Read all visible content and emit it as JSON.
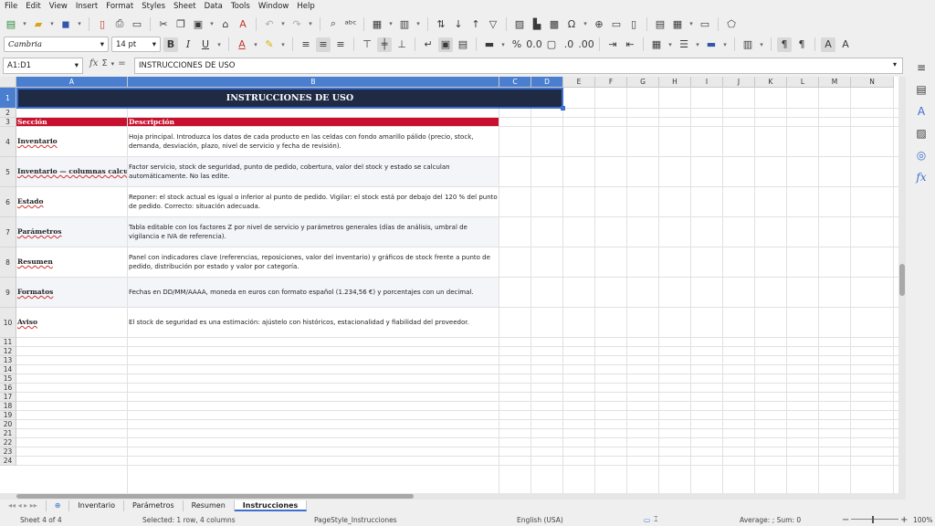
{
  "menu": [
    "File",
    "Edit",
    "View",
    "Insert",
    "Format",
    "Styles",
    "Sheet",
    "Data",
    "Tools",
    "Window",
    "Help"
  ],
  "font_name": "Cambria",
  "font_size": "14 pt",
  "name_box": "A1:D1",
  "formula": "INSTRUCCIONES DE USO",
  "columns": [
    "A",
    "B",
    "C",
    "D",
    "E",
    "F",
    "G",
    "H",
    "I",
    "J",
    "K",
    "L",
    "M",
    "N"
  ],
  "rows": [
    "1",
    "2",
    "3",
    "4",
    "5",
    "6",
    "7",
    "8",
    "9",
    "10",
    "11",
    "12",
    "13",
    "14",
    "15",
    "16",
    "17",
    "18",
    "19",
    "20",
    "21",
    "22",
    "23",
    "24"
  ],
  "title": "INSTRUCCIONES DE USO",
  "table": {
    "header_section": "Sección",
    "header_desc": "Descripción",
    "rows": [
      {
        "section": "Inventario",
        "desc": "Hoja principal. Introduzca los datos de cada producto en las celdas con fondo amarillo pálido (precio, stock, demanda, desviación, plazo, nivel de servicio y fecha de revisión)."
      },
      {
        "section": "Inventario — columnas calculadas",
        "desc": "Factor servicio, stock de seguridad, punto de pedido, cobertura, valor del stock y estado se calculan automáticamente. No las edite."
      },
      {
        "section": "Estado",
        "desc": "Reponer: el stock actual es igual o inferior al punto de pedido. Vigilar: el stock está por debajo del 120 % del punto de pedido. Correcto: situación adecuada."
      },
      {
        "section": "Parámetros",
        "desc": "Tabla editable con los factores Z por nivel de servicio y parámetros generales (días de análisis, umbral de vigilancia e IVA de referencia)."
      },
      {
        "section": "Resumen",
        "desc": "Panel con indicadores clave (referencias, reposiciones, valor del inventario) y gráficos de stock frente a punto de pedido, distribución por estado y valor por categoría."
      },
      {
        "section": "Formatos",
        "desc": "Fechas en DD/MM/AAAA, moneda en euros con formato español (1.234,56 €) y porcentajes con un decimal."
      },
      {
        "section": "Aviso",
        "desc": "El stock de seguridad es una estimación: ajústelo con históricos, estacionalidad y fiabilidad del proveedor."
      }
    ]
  },
  "tabs": [
    "Inventario",
    "Parámetros",
    "Resumen",
    "Instrucciones"
  ],
  "tab_add": "⊕",
  "status": {
    "sheet": "Sheet 4 of 4",
    "selected": "Selected: 1 row, 4 columns",
    "style": "PageStyle_Instrucciones",
    "lang": "English (USA)",
    "avg": "Average: ; Sum: 0",
    "zoom": "100%"
  },
  "accent": "#3b6fd0",
  "title_bg": "#1f2a44",
  "header_bg": "#c8102e"
}
